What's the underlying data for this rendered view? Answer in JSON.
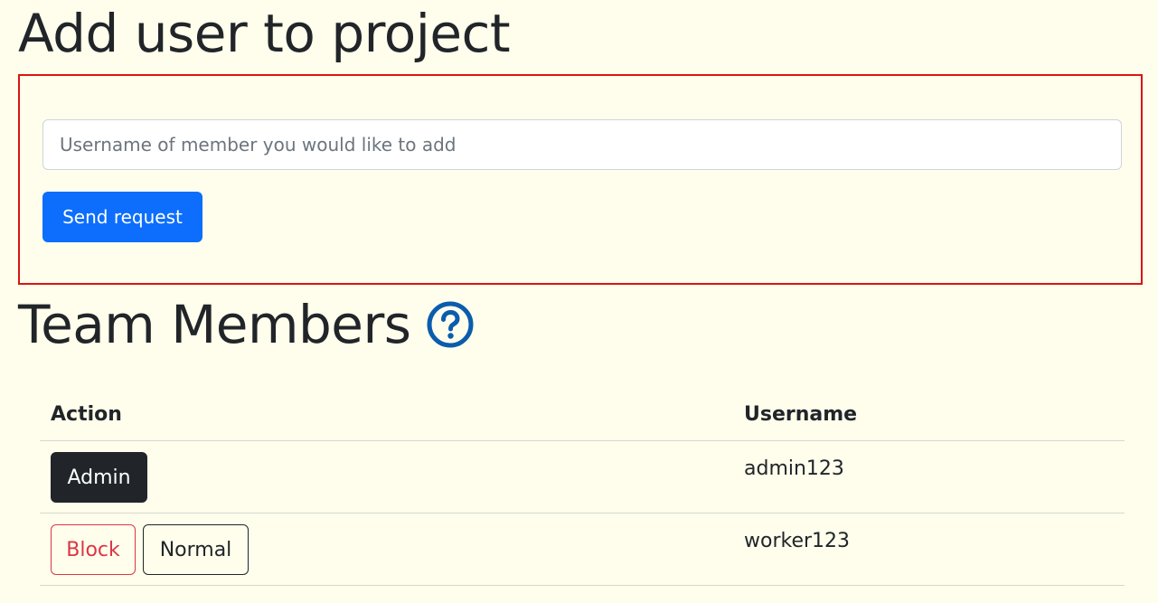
{
  "add_section": {
    "title": "Add user to project",
    "input_placeholder": "Username of member you would like to add",
    "input_value": "",
    "send_label": "Send request"
  },
  "team_section": {
    "title": "Team Members",
    "help_icon": "question-circle-icon",
    "columns": [
      "Action",
      "Username"
    ],
    "members": [
      {
        "username": "admin123",
        "actions": [
          "Admin"
        ]
      },
      {
        "username": "worker123",
        "actions": [
          "Block",
          "Normal"
        ]
      }
    ]
  },
  "colors": {
    "background": "#fffeec",
    "primary": "#0d6efd",
    "danger": "#dc3545",
    "dark": "#212529",
    "highlight_border": "#dc1414",
    "help_icon": "#0b5cad"
  }
}
